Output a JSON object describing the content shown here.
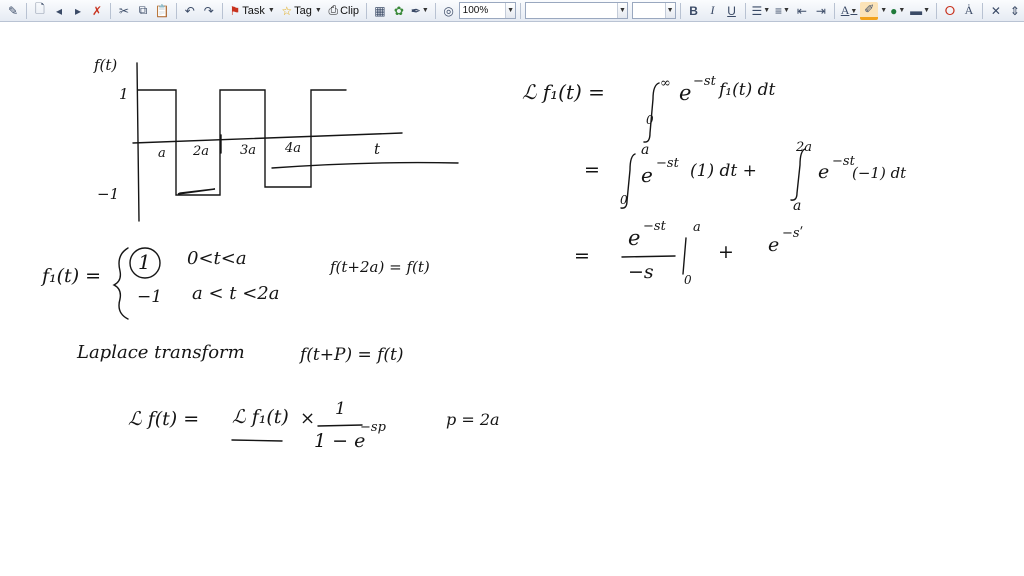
{
  "toolbar": {
    "task_label": "Task",
    "tag_label": "Tag",
    "clip_label": "Clip",
    "zoom_value": "100%",
    "font_value": "",
    "size_value": "",
    "bold_label": "B",
    "italic_label": "I",
    "underline_label": "U",
    "font_color_label": "A",
    "text_size_label": "Ȧ",
    "icons": [
      "pen-icon",
      "new-page-icon",
      "back-icon",
      "forward-icon",
      "delete-page-icon",
      "cut-icon",
      "copy-icon",
      "paste-icon",
      "undo-icon",
      "redo-icon",
      "flag-icon",
      "star-icon",
      "camera-icon",
      "table-icon",
      "insert-image-icon",
      "pen-select-icon",
      "circle-icon",
      "bullets-icon",
      "numbering-icon",
      "outdent-icon",
      "indent-icon",
      "highlighter-icon",
      "fill-color-icon",
      "line-style-icon",
      "lasso-icon",
      "close-icon",
      "move-space-icon"
    ],
    "accent_color": "#f2a21b",
    "flag_color": "#c8321e"
  },
  "notes": {
    "graph": {
      "f_label": "f(t)",
      "y_one": "1",
      "y_neg_one": "−1",
      "x_ticks": [
        "a",
        "2a",
        "3a",
        "4a"
      ],
      "t_label": "t"
    },
    "piecewise": {
      "lhs": "f₁(t) =",
      "case1_value": "1",
      "case1_range": "0<t<a",
      "case2_value": "−1",
      "case2_range": "a < t <2a",
      "period_note": "f(t+2a) = f(t)"
    },
    "laplace_heading": "Laplace transform",
    "periodicity": "f(t+P) = f(t)",
    "formula": {
      "lhs": "ℒ f(t) =",
      "term": "ℒ f₁(t)",
      "times": "×",
      "numerator": "1",
      "denominator": "1 − e",
      "denominator_exp": "−sp",
      "p_value": "p = 2a"
    },
    "right": {
      "line1_lhs": "ℒ f₁(t) =",
      "line1_upper": "∞",
      "line1_lower": "0",
      "line1_integrand": "e",
      "line1_exp": "−st",
      "line1_rest": "f₁(t) dt",
      "line2_eq": "=",
      "line2_int1_upper": "a",
      "line2_int1_lower": "0",
      "line2_int1": "e",
      "line2_int1_exp": "−st",
      "line2_int1_rest": "(1) dt +",
      "line2_int2_upper": "2a",
      "line2_int2_lower": "a",
      "line2_int2": "e",
      "line2_int2_exp": "−st",
      "line2_int2_rest": "(−1) dt",
      "line3_eq": "=",
      "line3_num": "e",
      "line3_num_exp": "−st",
      "line3_den": "−s",
      "line3_upper": "a",
      "line3_lower": "0",
      "line3_plus": "+",
      "line3_tail": "e",
      "line3_tail_exp": "−sʹ"
    }
  }
}
